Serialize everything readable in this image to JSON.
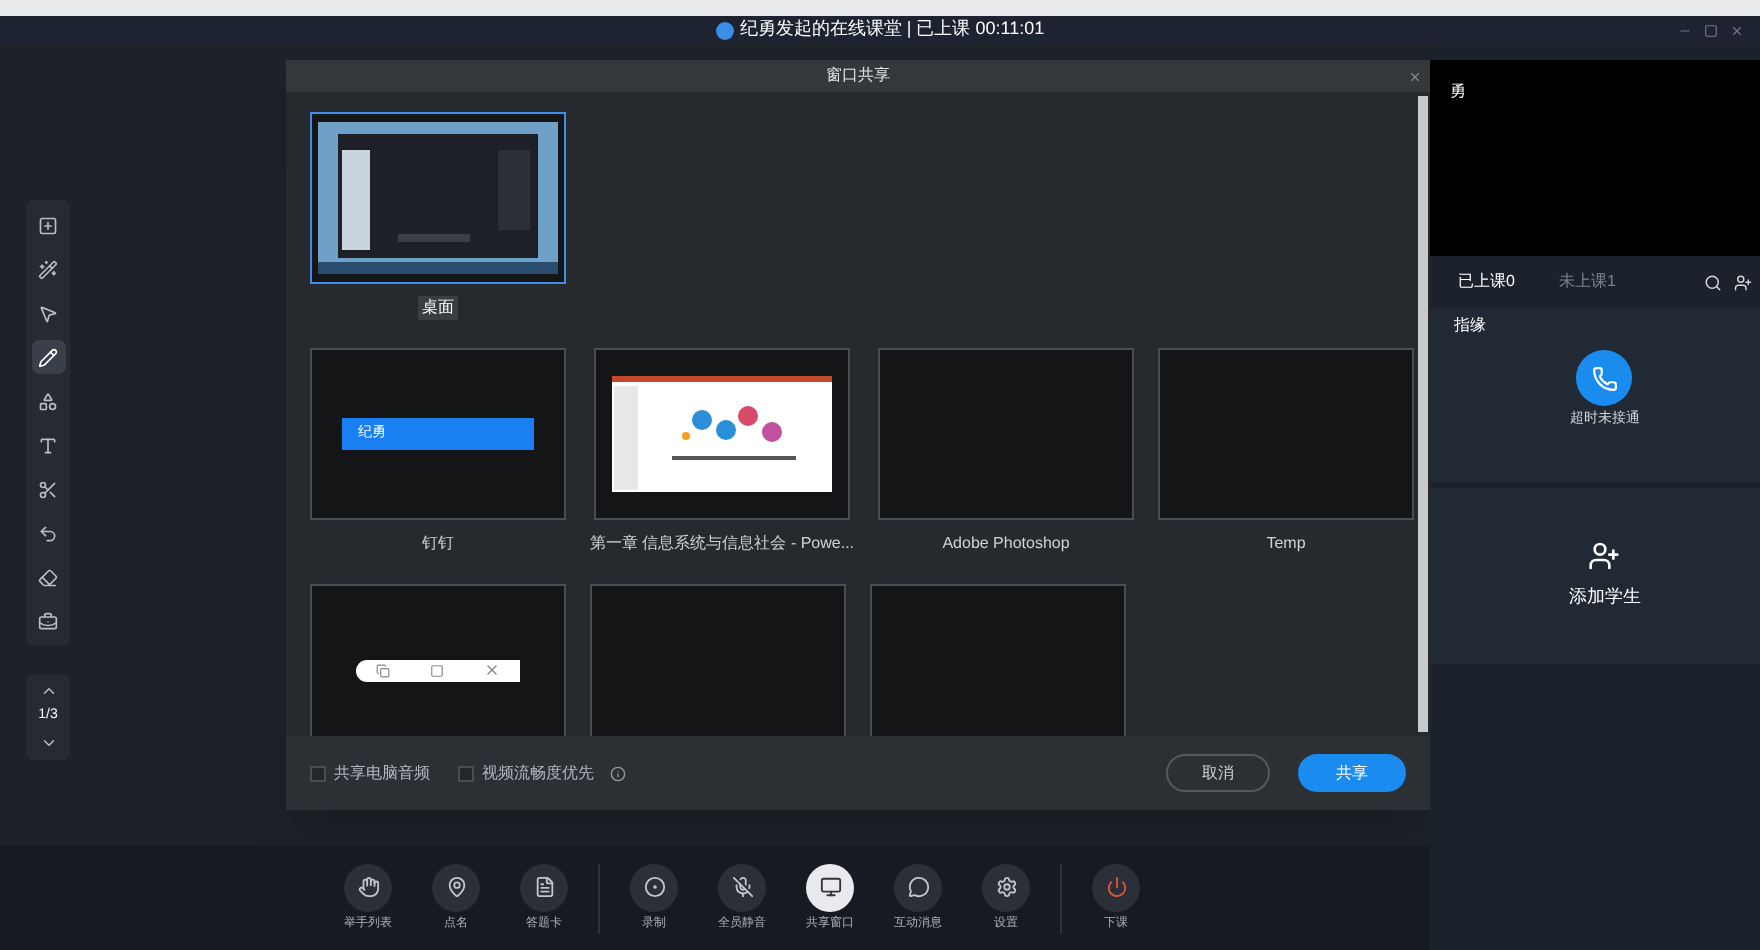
{
  "window": {
    "title": "纪勇发起的在线课堂 | 已上课 00:11:01"
  },
  "tools": [
    {
      "kind": "add-page",
      "selected": false
    },
    {
      "kind": "laser",
      "selected": false
    },
    {
      "kind": "select",
      "selected": false
    },
    {
      "kind": "pen",
      "selected": true
    },
    {
      "kind": "shapes",
      "selected": false
    },
    {
      "kind": "text",
      "selected": false
    },
    {
      "kind": "cut",
      "selected": false
    },
    {
      "kind": "undo",
      "selected": false
    },
    {
      "kind": "eraser",
      "selected": false
    },
    {
      "kind": "toolbox",
      "selected": false
    }
  ],
  "pager": {
    "label": "1/3"
  },
  "dialog": {
    "title": "窗口共享",
    "sources": [
      [
        {
          "kind": "desktop",
          "label": "桌面",
          "selected": true
        }
      ],
      [
        {
          "kind": "dingtalk",
          "label": "钉钉",
          "caption": "纪勇",
          "selected": false
        },
        {
          "kind": "slides",
          "label": "第一章 信息系统与信息社会 - Powe...",
          "selected": false
        },
        {
          "kind": "blank",
          "label": "Adobe Photoshop",
          "selected": false
        },
        {
          "kind": "blank",
          "label": "Temp",
          "selected": false
        }
      ],
      [
        {
          "kind": "window-bar",
          "selected": false
        },
        {
          "kind": "blank",
          "selected": false
        },
        {
          "kind": "blank",
          "selected": false
        }
      ]
    ],
    "options": [
      {
        "label": "共享电脑音频",
        "checked": false
      },
      {
        "label": "视频流畅度优先",
        "checked": false
      }
    ],
    "cancel": "取消",
    "confirm": "共享"
  },
  "side": {
    "video_label": "勇",
    "tabs": [
      {
        "label": "已上课0",
        "selected": true
      },
      {
        "label": "未上课1",
        "selected": false
      }
    ],
    "section": "指缘",
    "call_status": "超时未接通",
    "add_student": "添加学生"
  },
  "toolbar": [
    [
      {
        "kind": "hand",
        "label": "举手列表",
        "selected": false
      },
      {
        "kind": "rollcall",
        "label": "点名",
        "selected": false
      },
      {
        "kind": "quiz",
        "label": "答题卡",
        "selected": false
      }
    ],
    [
      {
        "kind": "record",
        "label": "录制",
        "selected": false
      },
      {
        "kind": "mute",
        "label": "全员静音",
        "selected": false
      },
      {
        "kind": "share",
        "label": "共享窗口",
        "selected": true
      },
      {
        "kind": "chat",
        "label": "互动消息",
        "selected": false
      },
      {
        "kind": "settings",
        "label": "设置",
        "selected": false
      }
    ],
    [
      {
        "kind": "end",
        "label": "下课",
        "selected": false
      }
    ]
  ]
}
